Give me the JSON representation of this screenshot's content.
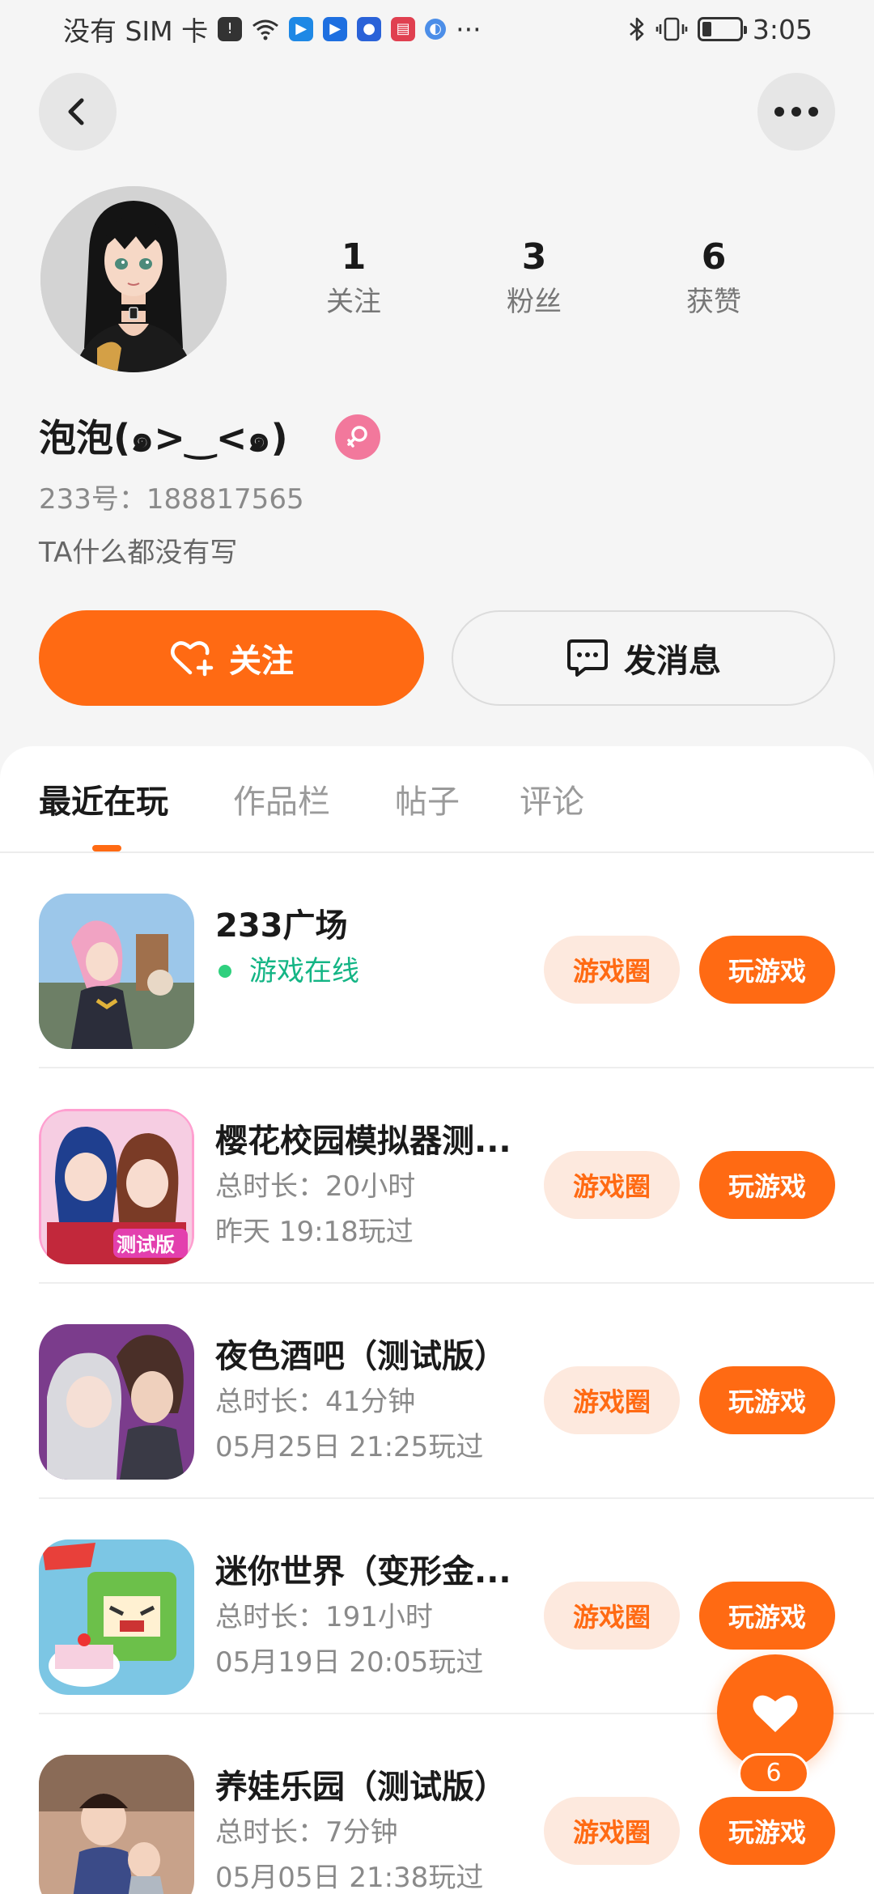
{
  "status_bar": {
    "carrier": "没有 SIM 卡",
    "more": "···",
    "time": "3:05",
    "battery_level": 0.25
  },
  "nav": {
    "back_icon": "chevron-left-icon",
    "more_icon": "more-dots-icon"
  },
  "profile": {
    "nickname": "泡泡(๑>‿<๑)",
    "gender_icon": "female-icon",
    "uid": "233号：188817565",
    "bio": "TA什么都没有写",
    "stats": [
      {
        "value": "1",
        "label": "关注"
      },
      {
        "value": "3",
        "label": "粉丝"
      },
      {
        "value": "6",
        "label": "获赞"
      }
    ]
  },
  "actions": {
    "follow": "关注",
    "message": "发消息"
  },
  "tabs": [
    "最近在玩",
    "作品栏",
    "帖子",
    "评论"
  ],
  "games": [
    {
      "title": "233广场",
      "online": "游戏在线",
      "circle": "游戏圈",
      "play": "玩游戏"
    },
    {
      "title": "樱花校园模拟器测...",
      "duration": "总时长：20小时",
      "last": "昨天 19:18玩过",
      "circle": "游戏圈",
      "play": "玩游戏"
    },
    {
      "title": "夜色酒吧（测试版）",
      "duration": "总时长：41分钟",
      "last": "05月25日 21:25玩过",
      "circle": "游戏圈",
      "play": "玩游戏"
    },
    {
      "title": "迷你世界（变形金...",
      "duration": "总时长：191小时",
      "last": "05月19日 20:05玩过",
      "circle": "游戏圈",
      "play": "玩游戏"
    },
    {
      "title": "养娃乐园（测试版）",
      "duration": "总时长：7分钟",
      "last": "05月05日 21:38玩过",
      "circle": "游戏圈",
      "play": "玩游戏"
    }
  ],
  "fab": {
    "icon": "heart-icon",
    "count": "6"
  },
  "colors": {
    "accent": "#ff6a13",
    "accent_soft": "#fde9de",
    "online": "#14b585"
  }
}
